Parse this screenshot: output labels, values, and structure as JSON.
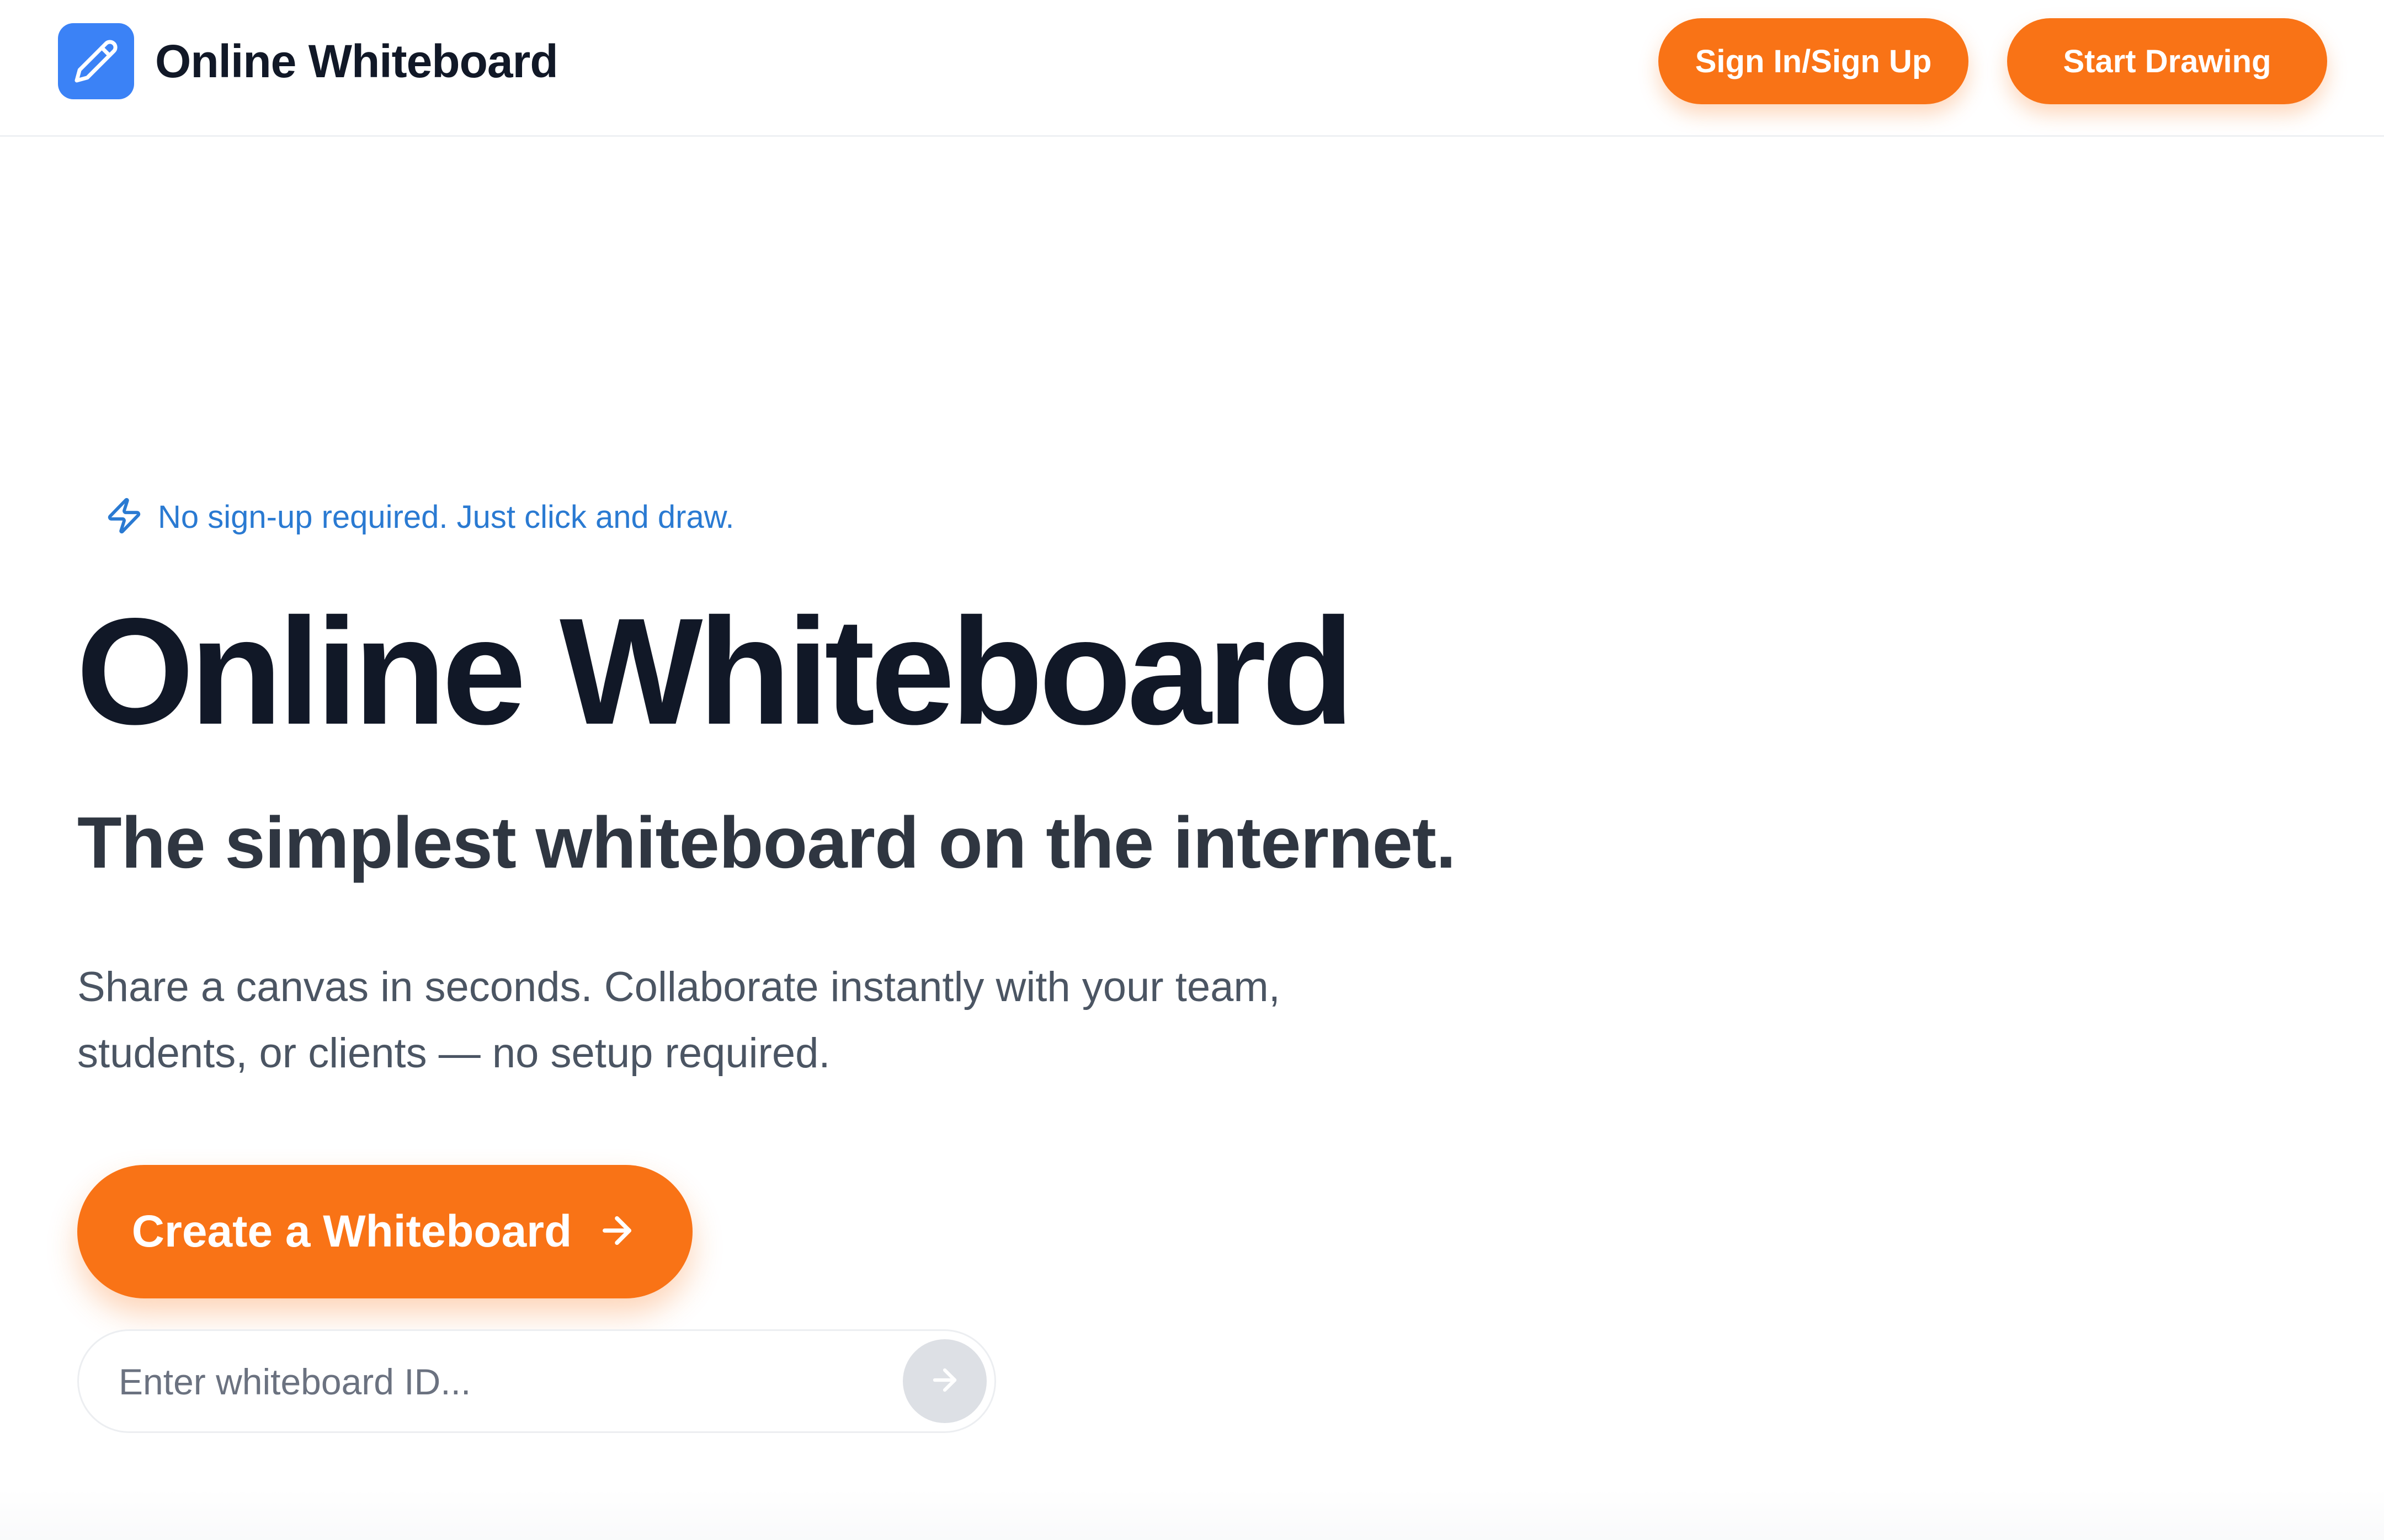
{
  "header": {
    "brand_name": "Online Whiteboard",
    "brand_icon": "pencil-icon",
    "signin_label": "Sign In/Sign Up",
    "start_label": "Start Drawing"
  },
  "hero": {
    "badge_icon": "lightning-icon",
    "badge_text": "No sign-up required. Just click and draw.",
    "title": "Online Whiteboard",
    "subtitle": "The simplest whiteboard on the internet.",
    "description": "Share a canvas in seconds. Collaborate instantly with your team, students, or clients — no setup required.",
    "cta_label": "Create a Whiteboard",
    "cta_icon": "arrow-right-icon"
  },
  "join": {
    "placeholder": "Enter whiteboard ID...",
    "value": "",
    "submit_icon": "arrow-right-icon"
  },
  "colors": {
    "accent": "#f97316",
    "brand_blue": "#3b82f6",
    "badge_blue": "#2a7ad2",
    "heading": "#111827"
  }
}
